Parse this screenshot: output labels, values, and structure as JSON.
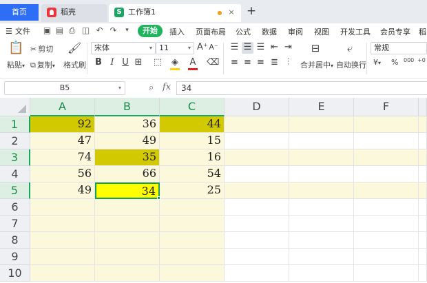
{
  "tabs": {
    "home": "首页",
    "docer": "稻壳",
    "workbook": "工作簿1",
    "workbook_icon": "S",
    "close": "×",
    "add": "+"
  },
  "menu": {
    "file_label": "文件",
    "start_label": "开始",
    "items": [
      "插入",
      "页面布局",
      "公式",
      "数据",
      "审阅",
      "视图",
      "开发工具",
      "会员专享",
      "稻"
    ]
  },
  "toolbar": {
    "paste_label": "粘贴",
    "cut_label": "剪切",
    "copy_label": "复制",
    "format_painter_label": "格式刷",
    "font_name": "宋体",
    "font_size": "11",
    "merge_center_label": "合并居中",
    "wrap_text_label": "自动换行",
    "number_format": "常规",
    "bold": "B",
    "italic": "I",
    "underline": "U",
    "font_color_letter": "A",
    "grow_font": "A⁺",
    "shrink_font": "A⁻",
    "currency": "¥",
    "percent": "%",
    "thousands": "000",
    "decimal": "+0"
  },
  "formula_bar": {
    "cell_ref": "B5",
    "fx_label": "fx",
    "formula": "34"
  },
  "sheet": {
    "columns": [
      "A",
      "B",
      "C",
      "D",
      "E",
      "F"
    ],
    "rows": [
      "1",
      "2",
      "3",
      "4",
      "5",
      "6",
      "7",
      "8",
      "9",
      "10"
    ],
    "cells": [
      [
        "92",
        "36",
        "44"
      ],
      [
        "47",
        "49",
        "15"
      ],
      [
        "74",
        "35",
        "16"
      ],
      [
        "56",
        "66",
        "54"
      ],
      [
        "49",
        "34",
        "25"
      ]
    ]
  },
  "colors": {
    "accent_green": "#1aa364",
    "home_blue": "#2e6df6",
    "highlight_dark_yellow": "#d3c900",
    "highlight_yellow": "#ffff00",
    "band_yellow": "#fbf8db"
  }
}
